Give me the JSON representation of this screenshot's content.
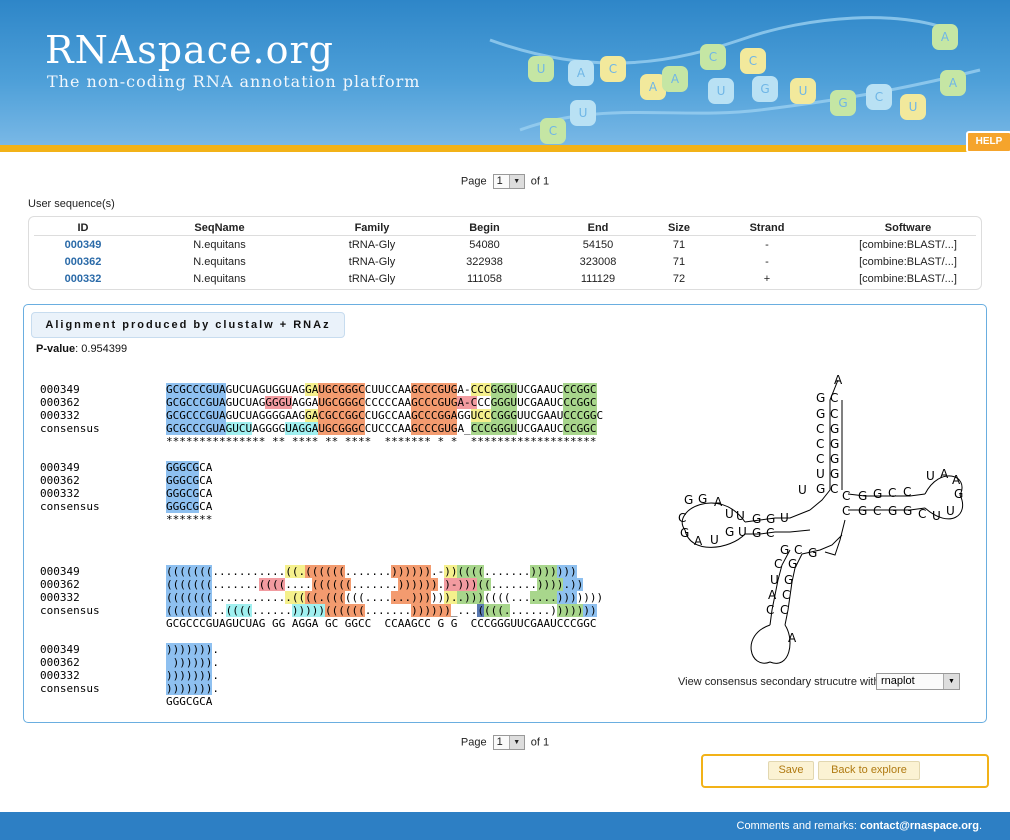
{
  "header": {
    "brand": "RNAspace.org",
    "tagline": "The non-coding RNA annotation platform",
    "help": "HELP",
    "puzzle_letters": [
      "U",
      "A",
      "C",
      "A",
      "A",
      "C",
      "U",
      "C",
      "G",
      "U",
      "G",
      "C",
      "U",
      "A",
      "A",
      "C",
      "U"
    ]
  },
  "pager": {
    "label": "Page",
    "value": "1",
    "of": "of 1"
  },
  "user_sequences": {
    "title": "User sequence(s)",
    "columns": [
      "ID",
      "SeqName",
      "Family",
      "Begin",
      "End",
      "Size",
      "Strand",
      "Software"
    ],
    "rows": [
      [
        "000349",
        "N.equitans",
        "tRNA-Gly",
        "54080",
        "54150",
        "71",
        "-",
        "[combine:BLAST/...]"
      ],
      [
        "000362",
        "N.equitans",
        "tRNA-Gly",
        "322938",
        "323008",
        "71",
        "-",
        "[combine:BLAST/...]"
      ],
      [
        "000332",
        "N.equitans",
        "tRNA-Gly",
        "111058",
        "111129",
        "72",
        "+",
        "[combine:BLAST/...]"
      ]
    ]
  },
  "alignment": {
    "title": "Alignment produced by clustalw + RNAz",
    "pvalue_label": "P-value",
    "pvalue": "0.954399",
    "block1": {
      "names": [
        "000349",
        "000362",
        "000332",
        "consensus"
      ],
      "seqs": [
        "GCGCCCGUAGUCUAGUGGUAGGAUGCGGGCCUUCCAAGCCCGUGA-CCCGGGUUCGAAUCCCGGC",
        "GCGCCCGUAGUCUAGGGGUAGGAUGCGGGCCCCCCAAGCCCGUGA-CCCGGGUUCGAAUCCCGGC",
        "GCGCCCGUAGUCUAGGGGAAGGACGCCGGCCUGCCAAGCCCGGAGGUCCCGGGUUCGAAUCCCGGC",
        "GCGCCCGUAGUCUAGGGGUAGGAUGCGGGCCUCCCAAGCCCGUGA_CCCGGGUUCGAAUCCCGGC"
      ],
      "stars": "*************** ** **** ** ****  ******* * *  *******************"
    },
    "block2": {
      "names": [
        "000349",
        "000362",
        "000332",
        "consensus"
      ],
      "seqs": [
        "GGGCGCA",
        "GGGCGCA",
        "GGGCGCA",
        "GGGCGCA"
      ],
      "stars": "*******"
    },
    "block3": {
      "names": [
        "000349",
        "000362",
        "000332",
        "consensus"
      ],
      "seqs": [
        "(((((((...........((.((((((.......)))))).-))((((.......)))))))",
        "(((((((.......((((....((((((.......)))))).)-)))((.......)))).))",
        "(((((((............((((.((((((.......))))))..)))((((.......)))))))",
        "(((((((..((((......)))))((((((.......))))))_...((((.......)))))))"
      ],
      "consensus_seq": "GCGCCCGUAGUCUAG GG AGGA GC GGCC  CCAAGCC G G  CCCGGGUUCGAAUCCCGGC"
    },
    "block4": {
      "names": [
        "000349",
        "000362",
        "000332",
        "consensus"
      ],
      "seqs": [
        "))))))).",
        " )))))).",
        "))))))).",
        ")))))))."
      ],
      "consensus_seq": "GGGCGCA"
    }
  },
  "structure": {
    "caption": "View consensus secondary strucutre with",
    "tool": "rnaplot",
    "letters": [
      "A",
      "G",
      "C",
      "G",
      "C",
      "C",
      "G",
      "C",
      "G",
      "C",
      "G",
      "U",
      "G",
      "U",
      "G",
      "C",
      "G",
      "G",
      "C",
      "C",
      "C",
      "C",
      "U",
      "A",
      "A",
      "G",
      "U",
      "U",
      "C",
      "G",
      "G",
      "C",
      "G",
      "U",
      "G",
      "G",
      "U",
      "U",
      "A",
      "G",
      "G",
      "C",
      "G",
      "A",
      "U",
      "G",
      "U",
      "G",
      "C",
      "G",
      "C",
      "G",
      "C",
      "G",
      "U",
      "G",
      "A",
      "C",
      "C",
      "C",
      "A"
    ]
  },
  "actions": {
    "save": "Save",
    "back": "Back to explore"
  },
  "footer": {
    "text": "Comments and remarks:",
    "email": "contact@rnaspace.org",
    "end": "."
  },
  "colors": {
    "blue": "#8ec0f0",
    "orange": "#f39b6f",
    "green": "#a8d68c",
    "yellow": "#f5f08c",
    "pink": "#f29ba0",
    "cyan": "#a0f0f0",
    "navy": "#5878b0"
  }
}
